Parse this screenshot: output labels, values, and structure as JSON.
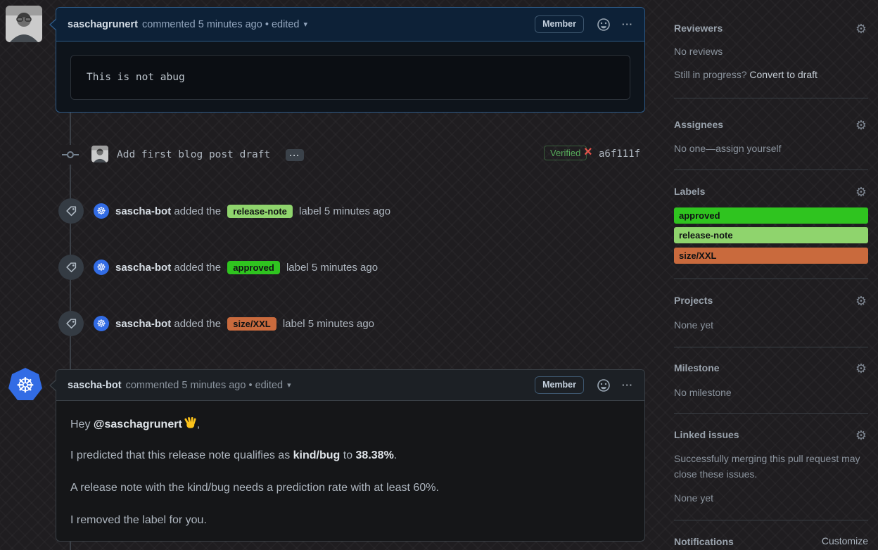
{
  "icons": {
    "gear": "⚙",
    "caret_down": "▾",
    "kebab": "···",
    "commit_ellipsis": "···",
    "k8s_wheel": "☸",
    "x_mark": "×",
    "dot_separator": "•"
  },
  "colors": {
    "highlight_border": "#2d5a87",
    "k8s_blue": "#326ce5",
    "verified_green": "#57ab5a",
    "failed_red": "#e5534b",
    "approved_bg": "#2fc41f",
    "release_note_bg": "#8fd46d",
    "size_xxl_bg": "#c96a3d"
  },
  "comment1": {
    "author": "saschagrunert",
    "meta": "commented 5 minutes ago • edited",
    "member_badge": "Member",
    "code": "This is not abug"
  },
  "commit": {
    "message": "Add first blog post draft",
    "verified_badge": "Verified",
    "sha": "a6f111f"
  },
  "events": [
    {
      "actor": "sascha-bot",
      "pre": "added the",
      "label": "release-note",
      "label_bg": "#8fd46d",
      "post": "label 5 minutes ago"
    },
    {
      "actor": "sascha-bot",
      "pre": "added the",
      "label": "approved",
      "label_bg": "#2fc41f",
      "post": "label 5 minutes ago"
    },
    {
      "actor": "sascha-bot",
      "pre": "added the",
      "label": "size/XXL",
      "label_bg": "#c96a3d",
      "post": "label 5 minutes ago"
    }
  ],
  "comment2": {
    "author": "sascha-bot",
    "meta": "commented 5 minutes ago • edited",
    "member_badge": "Member",
    "p1_prefix": "Hey ",
    "p1_mention": "@saschagrunert",
    "p1_suffix": ",",
    "p2_prefix": "I predicted that this release note qualifies as ",
    "p2_bold1": "kind/bug",
    "p2_mid": " to ",
    "p2_bold2": "38.38%",
    "p2_suffix": ".",
    "p3": "A release note with the kind/bug needs a prediction rate with at least 60%.",
    "p4": "I removed the label for you."
  },
  "sidebar": {
    "reviewers": {
      "title": "Reviewers",
      "empty": "No reviews",
      "progress_prefix": "Still in progress? ",
      "progress_link": "Convert to draft"
    },
    "assignees": {
      "title": "Assignees",
      "empty": "No one—assign yourself"
    },
    "labels": {
      "title": "Labels",
      "items": [
        {
          "name": "approved",
          "bg": "#2fc41f"
        },
        {
          "name": "release-note",
          "bg": "#8fd46d"
        },
        {
          "name": "size/XXL",
          "bg": "#c96a3d"
        }
      ]
    },
    "projects": {
      "title": "Projects",
      "empty": "None yet"
    },
    "milestone": {
      "title": "Milestone",
      "empty": "No milestone"
    },
    "linked_issues": {
      "title": "Linked issues",
      "desc": "Successfully merging this pull request may close these issues.",
      "empty": "None yet"
    },
    "notifications": {
      "title": "Notifications",
      "customize": "Customize"
    }
  }
}
